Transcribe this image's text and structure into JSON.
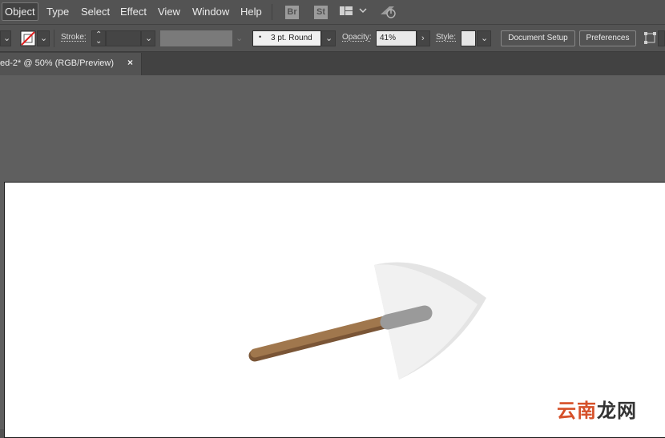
{
  "menubar": {
    "items": [
      "Object",
      "Type",
      "Select",
      "Effect",
      "View",
      "Window",
      "Help"
    ],
    "apps": [
      "Br",
      "St"
    ]
  },
  "controlbar": {
    "stroke_label": "Stroke:",
    "stroke_profile": "3 pt. Round",
    "opacity_label": "Opacity:",
    "opacity_value": "41%",
    "style_label": "Style:",
    "document_setup_label": "Document Setup",
    "preferences_label": "Preferences"
  },
  "document": {
    "tab_title": "ed-2* @ 50% (RGB/Preview)",
    "close_glyph": "×"
  },
  "watermark": {
    "part1": "云南",
    "part2": "龙网"
  },
  "colors": {
    "ui_dark": "#535353",
    "canvas": "#5f5f5f",
    "shovel_blade": "#f1f1f1",
    "shovel_blade_shadow": "#e4e4e4",
    "handle_brown": "#a0774d",
    "handle_dark": "#7a5536",
    "ferrule_gray": "#9a9a9a"
  }
}
